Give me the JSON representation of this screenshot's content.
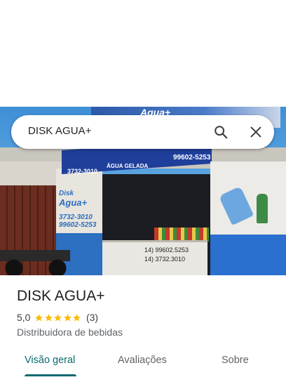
{
  "search": {
    "query": "DISK AGUA+",
    "search_icon": "search-icon",
    "close_icon": "close-icon"
  },
  "photo": {
    "sky_sign_text": "Agua+",
    "awning_phone": "3732-3010",
    "awning_label": "ÁGUA GELADA",
    "awning_mobile": "99602-5253",
    "pillar_text": [
      "Disk",
      "Agua+",
      "3732-3010",
      "99602-5253"
    ],
    "freezer_text": [
      "14) 99602.5253",
      "14) 3732.3010"
    ]
  },
  "place": {
    "name": "DISK AGUA+",
    "rating": "5,0",
    "stars": 5,
    "review_count": "(3)",
    "category": "Distribuidora de bebidas"
  },
  "tabs": [
    {
      "label": "Visão geral",
      "active": true
    },
    {
      "label": "Avaliações",
      "active": false
    },
    {
      "label": "Sobre",
      "active": false
    }
  ],
  "colors": {
    "accent": "#0b6b6e",
    "star": "#fbbc04",
    "text_primary": "#202124",
    "text_secondary": "#5f6368"
  }
}
